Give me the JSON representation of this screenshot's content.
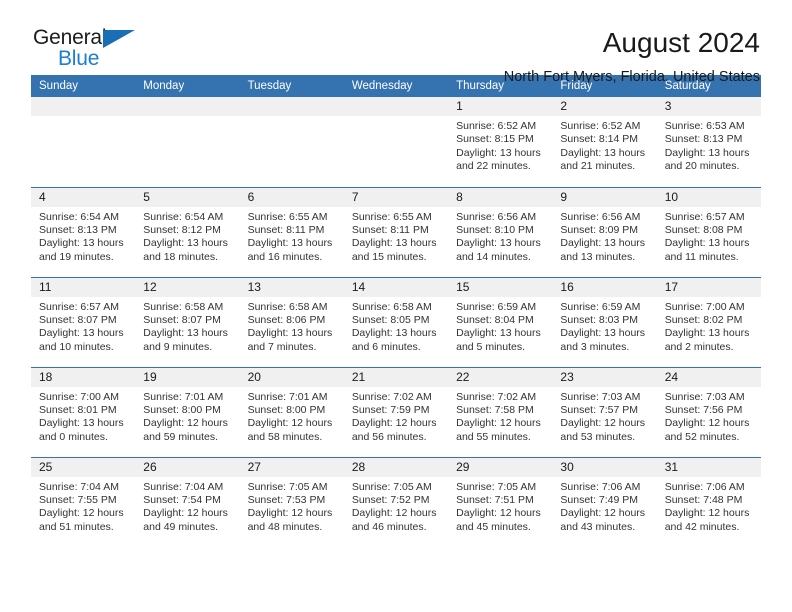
{
  "brand": {
    "name_part1": "General",
    "name_part2": "Blue",
    "triangle_icon": "blue-triangle-logo-mark",
    "accent_color": "#1b7fd4"
  },
  "header": {
    "title": "August 2024",
    "location": "North Fort Myers, Florida, United States"
  },
  "theme": {
    "header_blue": "#3572b0",
    "daynum_band": "#f0f0f0"
  },
  "weekday_headers": [
    "Sunday",
    "Monday",
    "Tuesday",
    "Wednesday",
    "Thursday",
    "Friday",
    "Saturday"
  ],
  "weeks": [
    [
      {
        "day": "",
        "empty": true
      },
      {
        "day": "",
        "empty": true
      },
      {
        "day": "",
        "empty": true
      },
      {
        "day": "",
        "empty": true
      },
      {
        "day": "1",
        "sunrise": "Sunrise: 6:52 AM",
        "sunset": "Sunset: 8:15 PM",
        "daylight": "Daylight: 13 hours and 22 minutes."
      },
      {
        "day": "2",
        "sunrise": "Sunrise: 6:52 AM",
        "sunset": "Sunset: 8:14 PM",
        "daylight": "Daylight: 13 hours and 21 minutes."
      },
      {
        "day": "3",
        "sunrise": "Sunrise: 6:53 AM",
        "sunset": "Sunset: 8:13 PM",
        "daylight": "Daylight: 13 hours and 20 minutes."
      }
    ],
    [
      {
        "day": "4",
        "sunrise": "Sunrise: 6:54 AM",
        "sunset": "Sunset: 8:13 PM",
        "daylight": "Daylight: 13 hours and 19 minutes."
      },
      {
        "day": "5",
        "sunrise": "Sunrise: 6:54 AM",
        "sunset": "Sunset: 8:12 PM",
        "daylight": "Daylight: 13 hours and 18 minutes."
      },
      {
        "day": "6",
        "sunrise": "Sunrise: 6:55 AM",
        "sunset": "Sunset: 8:11 PM",
        "daylight": "Daylight: 13 hours and 16 minutes."
      },
      {
        "day": "7",
        "sunrise": "Sunrise: 6:55 AM",
        "sunset": "Sunset: 8:11 PM",
        "daylight": "Daylight: 13 hours and 15 minutes."
      },
      {
        "day": "8",
        "sunrise": "Sunrise: 6:56 AM",
        "sunset": "Sunset: 8:10 PM",
        "daylight": "Daylight: 13 hours and 14 minutes."
      },
      {
        "day": "9",
        "sunrise": "Sunrise: 6:56 AM",
        "sunset": "Sunset: 8:09 PM",
        "daylight": "Daylight: 13 hours and 13 minutes."
      },
      {
        "day": "10",
        "sunrise": "Sunrise: 6:57 AM",
        "sunset": "Sunset: 8:08 PM",
        "daylight": "Daylight: 13 hours and 11 minutes."
      }
    ],
    [
      {
        "day": "11",
        "sunrise": "Sunrise: 6:57 AM",
        "sunset": "Sunset: 8:07 PM",
        "daylight": "Daylight: 13 hours and 10 minutes."
      },
      {
        "day": "12",
        "sunrise": "Sunrise: 6:58 AM",
        "sunset": "Sunset: 8:07 PM",
        "daylight": "Daylight: 13 hours and 9 minutes."
      },
      {
        "day": "13",
        "sunrise": "Sunrise: 6:58 AM",
        "sunset": "Sunset: 8:06 PM",
        "daylight": "Daylight: 13 hours and 7 minutes."
      },
      {
        "day": "14",
        "sunrise": "Sunrise: 6:58 AM",
        "sunset": "Sunset: 8:05 PM",
        "daylight": "Daylight: 13 hours and 6 minutes."
      },
      {
        "day": "15",
        "sunrise": "Sunrise: 6:59 AM",
        "sunset": "Sunset: 8:04 PM",
        "daylight": "Daylight: 13 hours and 5 minutes."
      },
      {
        "day": "16",
        "sunrise": "Sunrise: 6:59 AM",
        "sunset": "Sunset: 8:03 PM",
        "daylight": "Daylight: 13 hours and 3 minutes."
      },
      {
        "day": "17",
        "sunrise": "Sunrise: 7:00 AM",
        "sunset": "Sunset: 8:02 PM",
        "daylight": "Daylight: 13 hours and 2 minutes."
      }
    ],
    [
      {
        "day": "18",
        "sunrise": "Sunrise: 7:00 AM",
        "sunset": "Sunset: 8:01 PM",
        "daylight": "Daylight: 13 hours and 0 minutes."
      },
      {
        "day": "19",
        "sunrise": "Sunrise: 7:01 AM",
        "sunset": "Sunset: 8:00 PM",
        "daylight": "Daylight: 12 hours and 59 minutes."
      },
      {
        "day": "20",
        "sunrise": "Sunrise: 7:01 AM",
        "sunset": "Sunset: 8:00 PM",
        "daylight": "Daylight: 12 hours and 58 minutes."
      },
      {
        "day": "21",
        "sunrise": "Sunrise: 7:02 AM",
        "sunset": "Sunset: 7:59 PM",
        "daylight": "Daylight: 12 hours and 56 minutes."
      },
      {
        "day": "22",
        "sunrise": "Sunrise: 7:02 AM",
        "sunset": "Sunset: 7:58 PM",
        "daylight": "Daylight: 12 hours and 55 minutes."
      },
      {
        "day": "23",
        "sunrise": "Sunrise: 7:03 AM",
        "sunset": "Sunset: 7:57 PM",
        "daylight": "Daylight: 12 hours and 53 minutes."
      },
      {
        "day": "24",
        "sunrise": "Sunrise: 7:03 AM",
        "sunset": "Sunset: 7:56 PM",
        "daylight": "Daylight: 12 hours and 52 minutes."
      }
    ],
    [
      {
        "day": "25",
        "sunrise": "Sunrise: 7:04 AM",
        "sunset": "Sunset: 7:55 PM",
        "daylight": "Daylight: 12 hours and 51 minutes."
      },
      {
        "day": "26",
        "sunrise": "Sunrise: 7:04 AM",
        "sunset": "Sunset: 7:54 PM",
        "daylight": "Daylight: 12 hours and 49 minutes."
      },
      {
        "day": "27",
        "sunrise": "Sunrise: 7:05 AM",
        "sunset": "Sunset: 7:53 PM",
        "daylight": "Daylight: 12 hours and 48 minutes."
      },
      {
        "day": "28",
        "sunrise": "Sunrise: 7:05 AM",
        "sunset": "Sunset: 7:52 PM",
        "daylight": "Daylight: 12 hours and 46 minutes."
      },
      {
        "day": "29",
        "sunrise": "Sunrise: 7:05 AM",
        "sunset": "Sunset: 7:51 PM",
        "daylight": "Daylight: 12 hours and 45 minutes."
      },
      {
        "day": "30",
        "sunrise": "Sunrise: 7:06 AM",
        "sunset": "Sunset: 7:49 PM",
        "daylight": "Daylight: 12 hours and 43 minutes."
      },
      {
        "day": "31",
        "sunrise": "Sunrise: 7:06 AM",
        "sunset": "Sunset: 7:48 PM",
        "daylight": "Daylight: 12 hours and 42 minutes."
      }
    ]
  ]
}
